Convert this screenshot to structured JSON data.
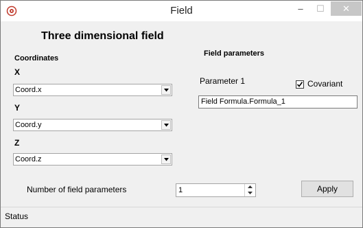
{
  "window": {
    "title": "Field",
    "min_glyph": "–",
    "max_glyph": "☐",
    "close_glyph": "✕"
  },
  "heading": "Three dimensional field",
  "coordinates": {
    "title": "Coordinates",
    "x": {
      "label": "X",
      "value": "Coord.x"
    },
    "y": {
      "label": "Y",
      "value": "Coord.y"
    },
    "z": {
      "label": "Z",
      "value": "Coord.z"
    }
  },
  "field_parameters": {
    "title": "Field parameters",
    "param_label": "Parameter 1",
    "covariant_label": "Covariant",
    "covariant_checked": true,
    "formula_value": "Field Formula.Formula_1"
  },
  "num_params": {
    "label": "Number of field parameters",
    "value": "1"
  },
  "apply_label": "Apply",
  "status": "Status"
}
